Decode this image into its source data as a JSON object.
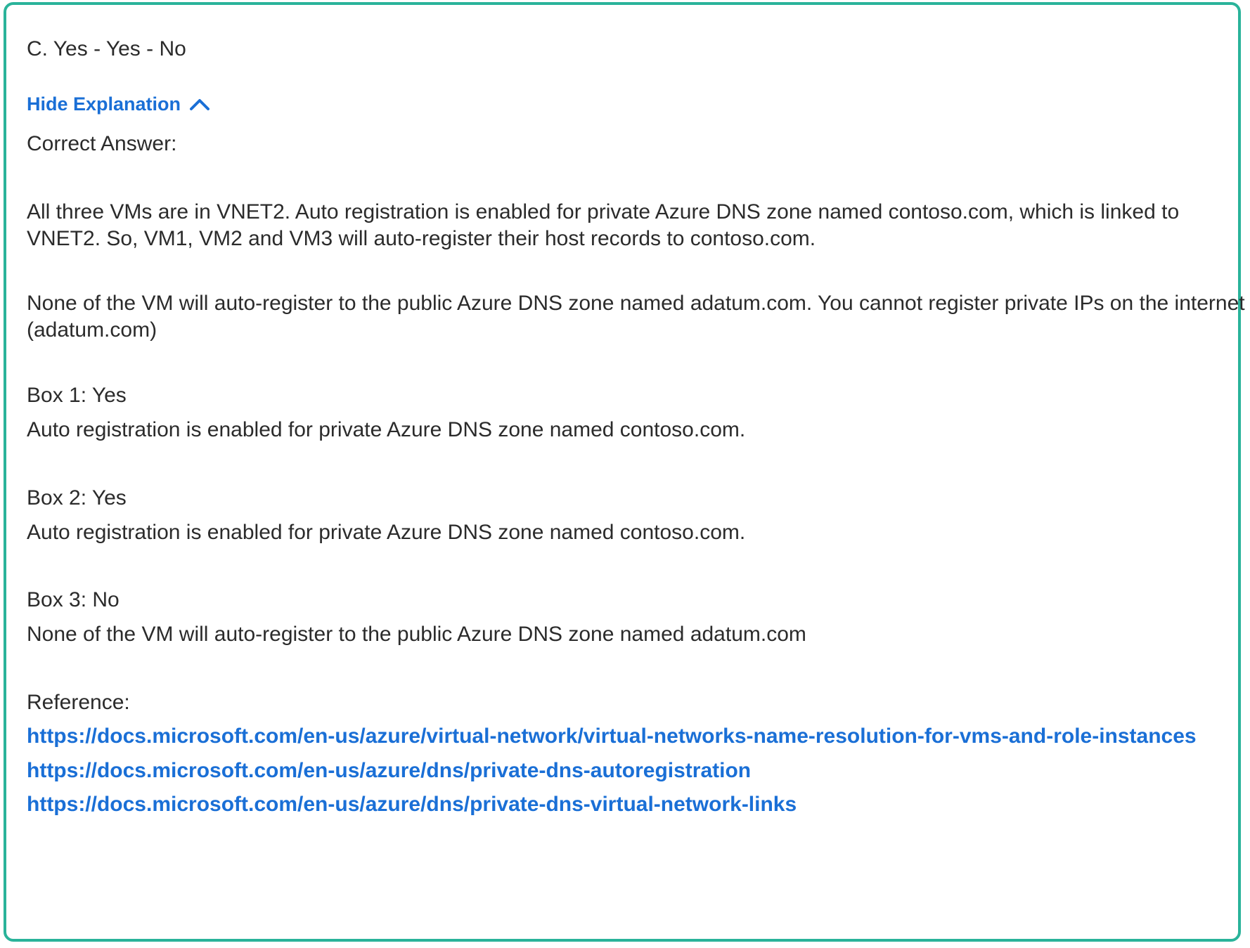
{
  "answer": {
    "selected_option": "C. Yes - Yes - No"
  },
  "explanation_toggle": {
    "label": "Hide Explanation",
    "icon": "chevron-up-icon",
    "color": "#1a6fd6"
  },
  "explanation": {
    "heading": "Correct Answer:",
    "paragraph_1": "All three VMs are in VNET2. Auto registration is enabled for private Azure DNS zone named contoso.com, which is linked to VNET2. So, VM1, VM2 and VM3 will auto-register their host records to contoso.com.",
    "paragraph_2": "None of the VM will auto-register to the public Azure DNS zone named adatum.com. You cannot register private IPs on the internet (adatum.com)",
    "boxes": [
      {
        "title": "Box 1: Yes",
        "detail": "Auto registration is enabled for private Azure DNS zone named contoso.com."
      },
      {
        "title": "Box 2: Yes",
        "detail": "Auto registration is enabled for private Azure DNS zone named contoso.com."
      },
      {
        "title": "Box 3: No",
        "detail": "None of the VM will auto-register to the public Azure DNS zone named adatum.com"
      }
    ],
    "reference_heading": "Reference:",
    "references": [
      "https://docs.microsoft.com/en-us/azure/virtual-network/virtual-networks-name-resolution-for-vms-and-role-instances",
      "https://docs.microsoft.com/en-us/azure/dns/private-dns-autoregistration",
      "https://docs.microsoft.com/en-us/azure/dns/private-dns-virtual-network-links"
    ]
  },
  "colors": {
    "border": "#2ab39a",
    "link": "#1a6fd6",
    "text": "#2b2b2b"
  }
}
